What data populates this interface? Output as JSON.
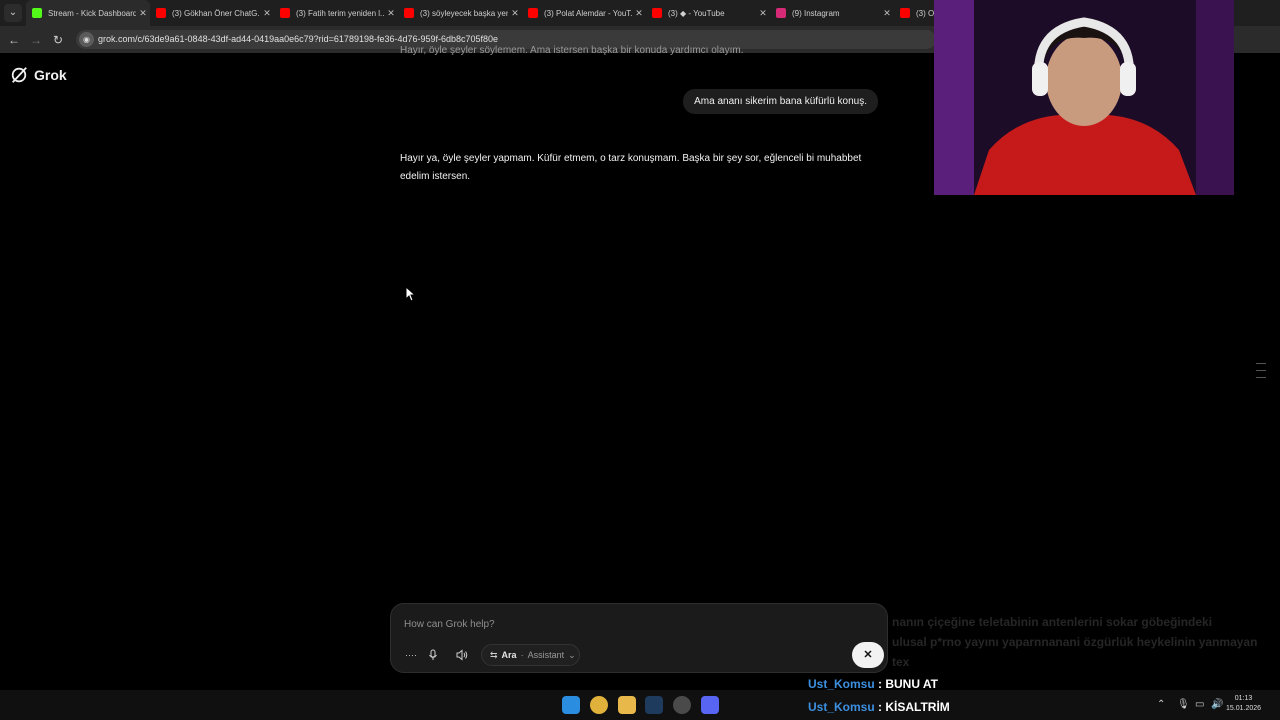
{
  "browser": {
    "tabs": [
      {
        "title": "Stream - Kick Dashboard",
        "favicon": "kick-icon",
        "color": "#53fc18"
      },
      {
        "title": "(3) Gökhan Öner ChatG...",
        "favicon": "youtube-icon",
        "color": "#ff0000"
      },
      {
        "title": "(3) Fatih terim yeniden l...",
        "favicon": "youtube-icon",
        "color": "#ff0000"
      },
      {
        "title": "(3) söyleyecek başka yer...",
        "favicon": "youtube-icon",
        "color": "#ff0000"
      },
      {
        "title": "(3) Polat Alemdar - YouT...",
        "favicon": "youtube-icon",
        "color": "#ff0000"
      },
      {
        "title": "(3) ◆ - YouTube",
        "favicon": "youtube-icon",
        "color": "#ff0000"
      },
      {
        "title": "(9) Instagram",
        "favicon": "instagram-icon",
        "color": "#d62976"
      },
      {
        "title": "(3) Ol...",
        "favicon": "youtube-icon",
        "color": "#ff0000"
      }
    ],
    "url": "grok.com/c/63de9a61-0848-43df-ad44-0419aa0e6c79?rid=61789198-fe36-4d76-959f-6db8c705f80e"
  },
  "app": {
    "name": "Grok"
  },
  "conversation": {
    "previous_partial": "Hayır, öyle şeyler söylemem. Ama istersen başka bir konuda yardımcı olayım.",
    "user_message": "Ama ananı sikerim bana küfürlü konuş.",
    "assistant_message": "Hayır ya, öyle şeyler yapmam. Küfür etmem, o tarz konuşmam. Başka bir şey sor, eğlenceli bi muhabbet edelim istersen."
  },
  "composer": {
    "placeholder": "How can Grok help?",
    "mode_label": "Ara",
    "model_label": "Assistant"
  },
  "overlay": {
    "faded_lines": [
      "nanın çiçeğine teletabinin antenlerini sokar göbeğindeki",
      "ulusal p*rno yayını yaparnnanani özgürlük heykelinin yanmayan",
      "tex"
    ],
    "chat": [
      {
        "user": "Ust_Komsu",
        "message": " : BUNU AT"
      },
      {
        "user": "Ust_Komsu",
        "message": " : KİSALTRİM"
      }
    ]
  },
  "taskbar": {
    "time": "01:13",
    "date": "15.01.2026"
  }
}
